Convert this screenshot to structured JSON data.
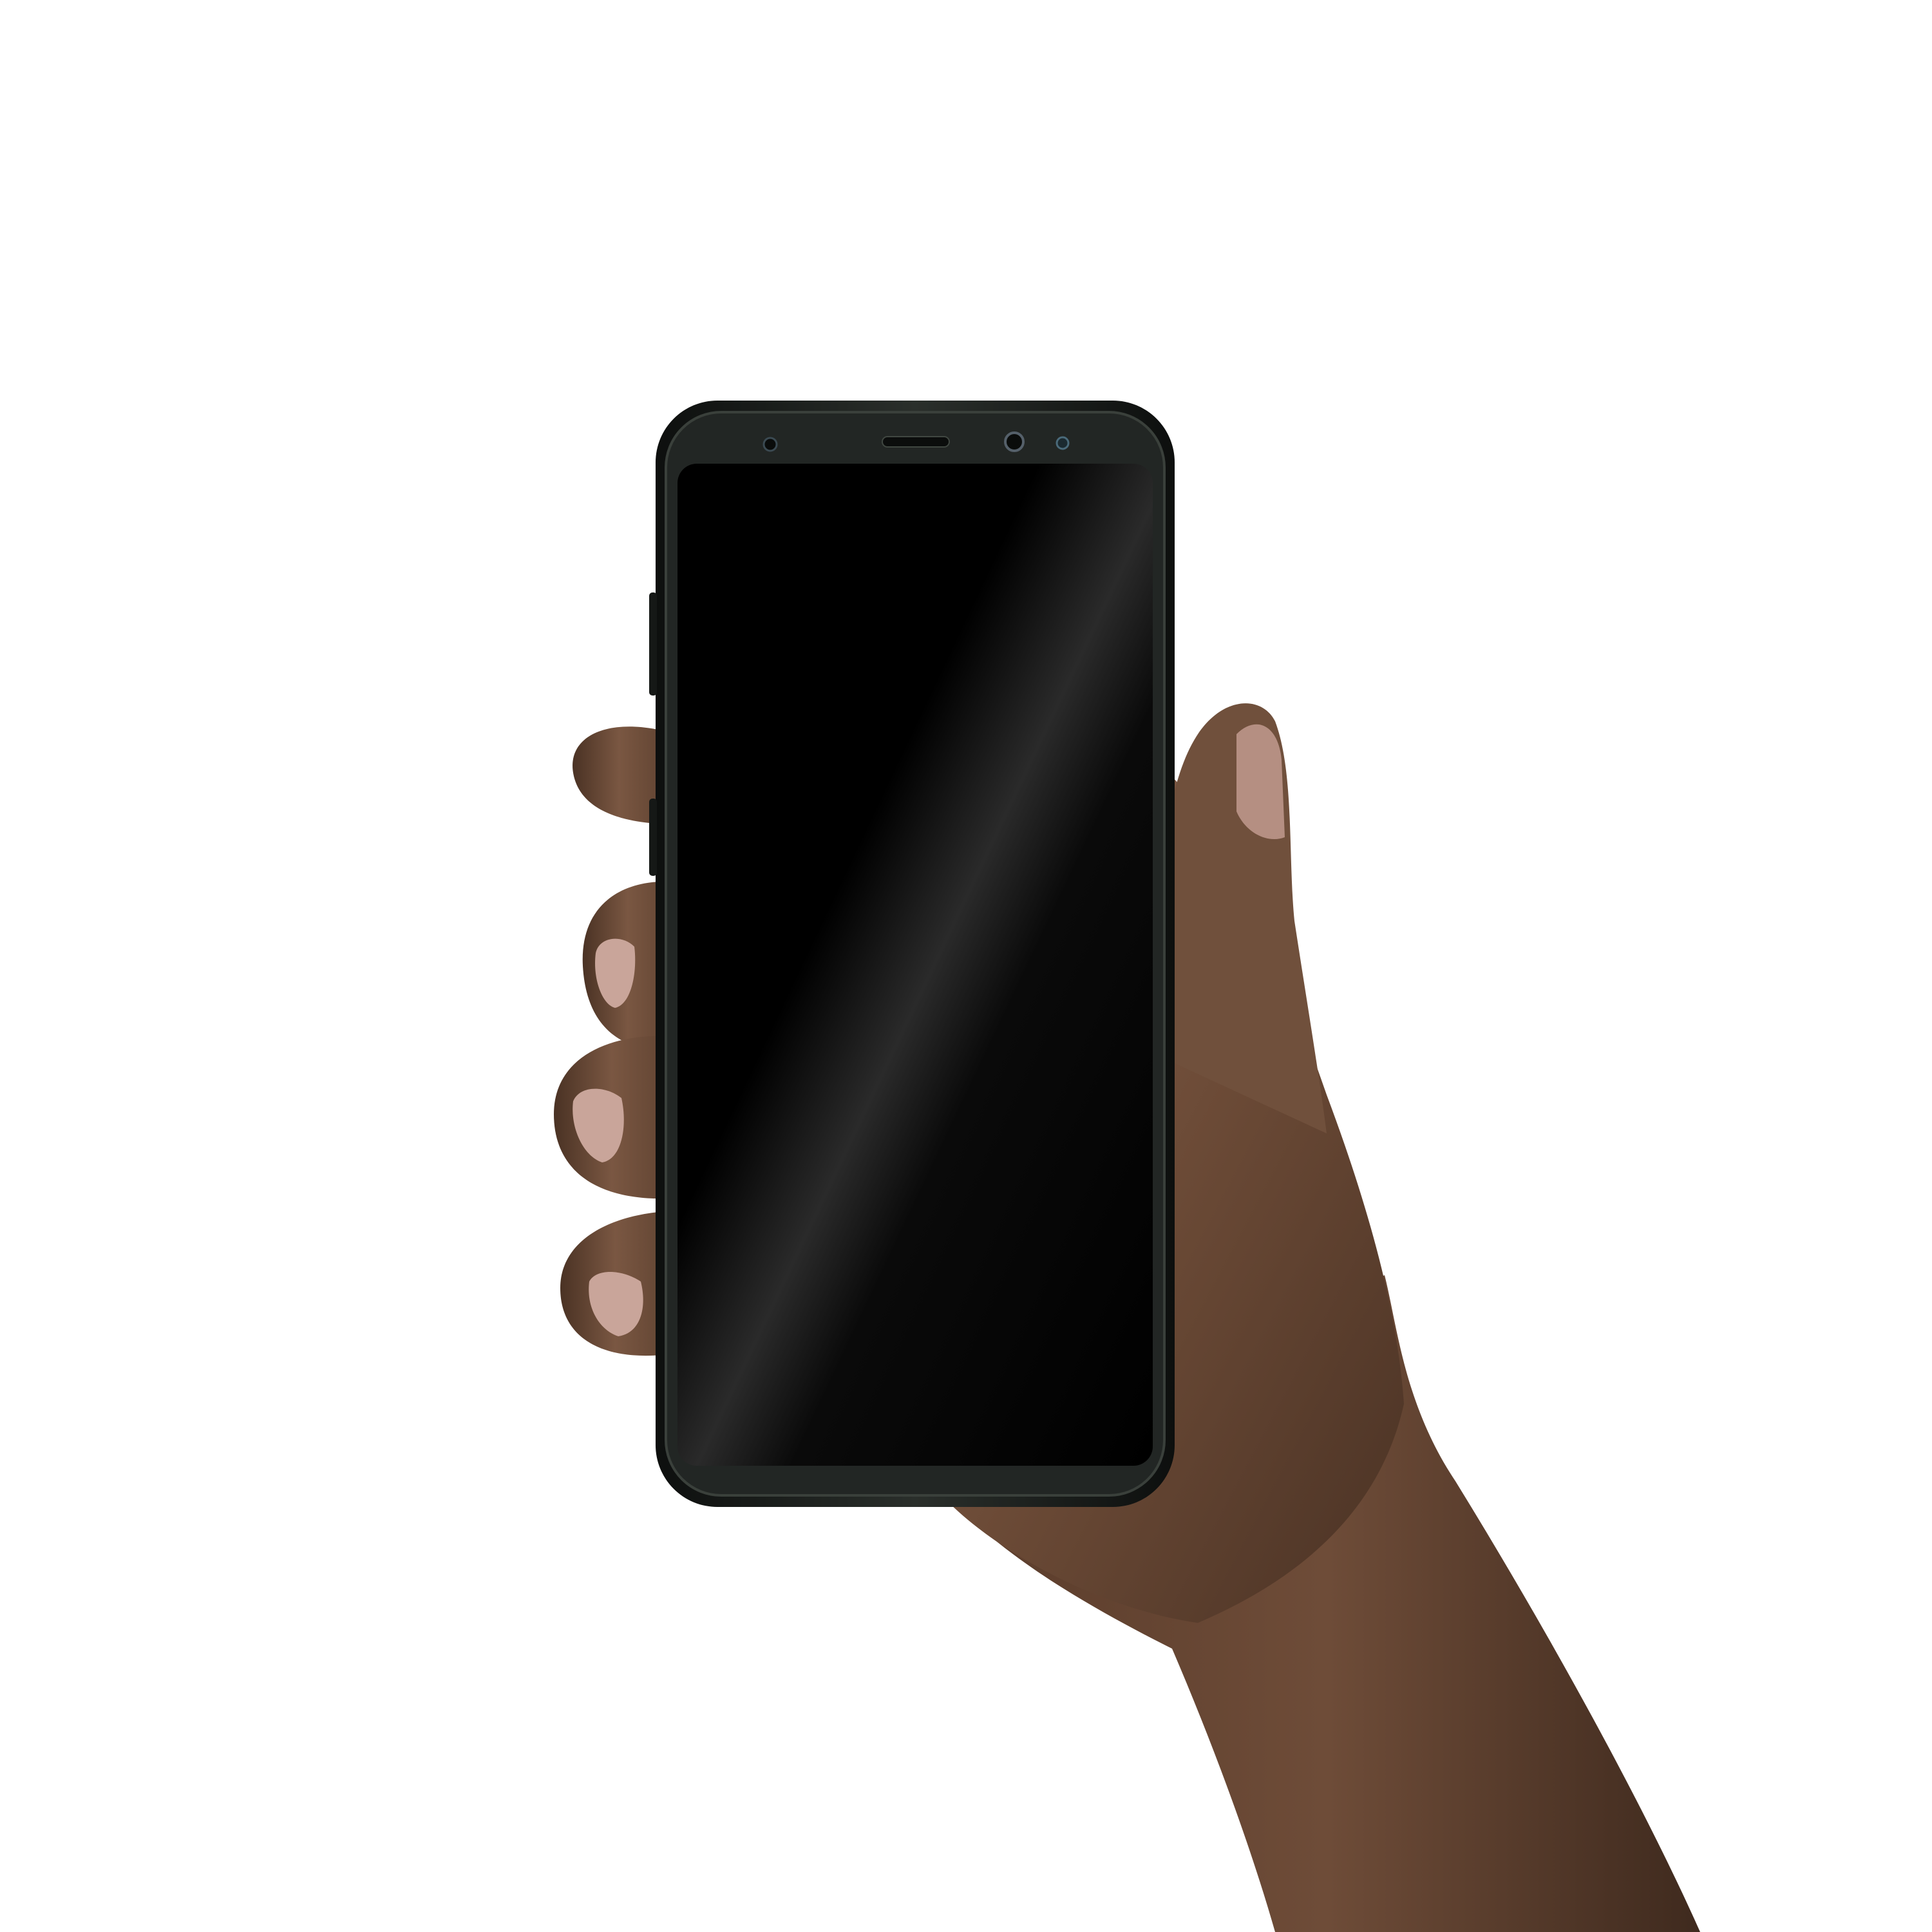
{
  "scene": {
    "background_color": "#ffffff",
    "subject": "hand-holding-smartphone",
    "screen_state": "off",
    "colors": {
      "phone_body": "#1a1d1b",
      "phone_bezel": "#2b302c",
      "screen": "#000000",
      "skin_base": "#6b4a36",
      "skin_highlight": "#8a6450",
      "skin_shadow": "#3f2a1e",
      "nail": "#c9a59a",
      "lens_accent": "#4a6a7a"
    }
  }
}
